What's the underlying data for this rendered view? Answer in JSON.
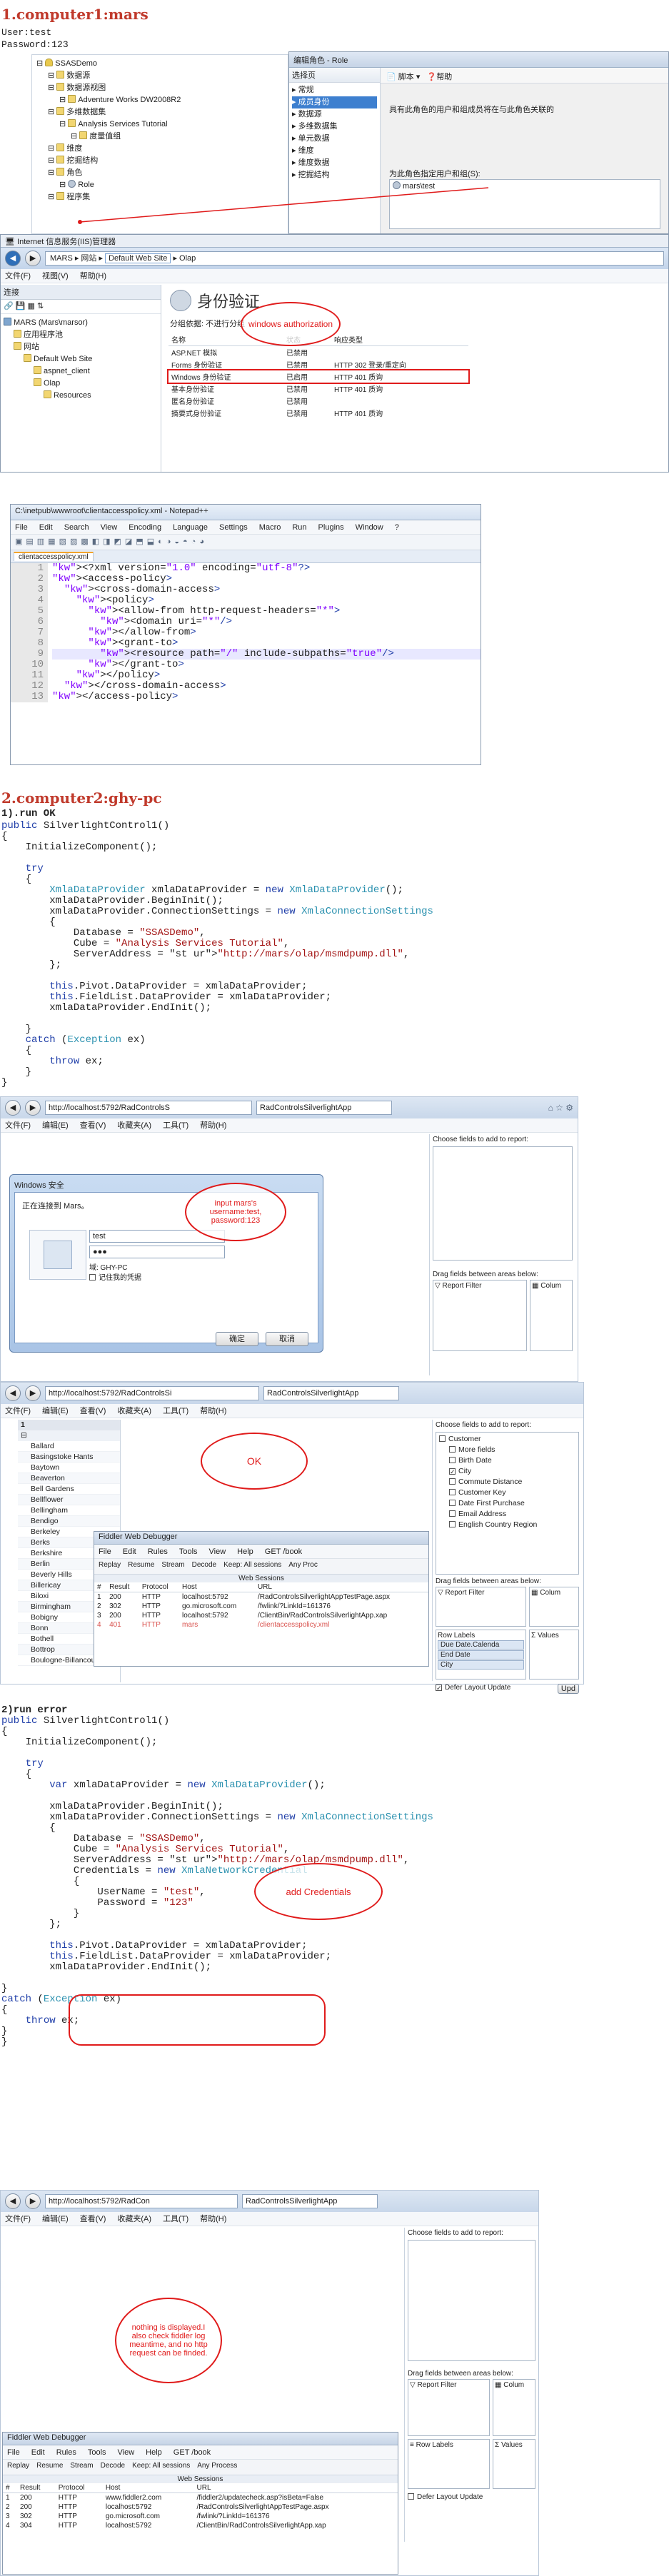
{
  "section1": {
    "heading": "1.computer1:mars",
    "user_line": "User:test",
    "password_line": "Password:123"
  },
  "ssms": {
    "tree": [
      "SSASDemo",
      "数据源",
      "数据源视图",
      "Adventure Works DW2008R2",
      "多维数据集",
      "Analysis Services Tutorial",
      "度量值组",
      "维度",
      "挖掘结构",
      "角色",
      "Role",
      "程序集"
    ],
    "role_window_title": "编辑角色 - Role",
    "select_page_label": "选择页",
    "pages": [
      "常规",
      "成员身份",
      "数据源",
      "多维数据集",
      "单元数据",
      "维度",
      "维度数据",
      "挖掘结构"
    ],
    "toolbar_script": "脚本",
    "toolbar_help": "帮助",
    "membership_desc": "具有此角色的用户和组成员将在与此角色关联的",
    "members_label": "为此角色指定用户和组(S):",
    "member_entry": "mars\\test"
  },
  "iis": {
    "title": "Internet 信息服务(IIS)管理器",
    "address_parts": [
      "MARS",
      "网站",
      "Default Web Site",
      "Olap"
    ],
    "menu": [
      "文件(F)",
      "视图(V)",
      "帮助(H)"
    ],
    "connections_label": "连接",
    "tree": [
      "MARS (Mars\\marsor)",
      "应用程序池",
      "网站",
      "Default Web Site",
      "aspnet_client",
      "Olap",
      "Resources"
    ],
    "page_title": "身份验证",
    "group_by": "分组依据: 不进行分组",
    "columns": [
      "名称",
      "状态",
      "响应类型"
    ],
    "rows": [
      {
        "name": "ASP.NET 模拟",
        "status": "已禁用",
        "response": ""
      },
      {
        "name": "Forms 身份验证",
        "status": "已禁用",
        "response": "HTTP 302 登录/重定向"
      },
      {
        "name": "Windows 身份验证",
        "status": "已启用",
        "response": "HTTP 401 质询"
      },
      {
        "name": "基本身份验证",
        "status": "已禁用",
        "response": "HTTP 401 质询"
      },
      {
        "name": "匿名身份验证",
        "status": "已禁用",
        "response": ""
      },
      {
        "name": "摘要式身份验证",
        "status": "已禁用",
        "response": "HTTP 401 质询"
      }
    ],
    "callout": "windows authorization"
  },
  "notepad": {
    "title": "C:\\inetpub\\wwwroot\\clientaccesspolicy.xml - Notepad++",
    "menu": [
      "File",
      "Edit",
      "Search",
      "View",
      "Encoding",
      "Language",
      "Settings",
      "Macro",
      "Run",
      "Plugins",
      "Window",
      "?"
    ],
    "tab": "clientaccesspolicy.xml",
    "lines": [
      "<?xml version=\"1.0\" encoding=\"utf-8\"?>",
      "<access-policy>",
      "  <cross-domain-access>",
      "    <policy>",
      "      <allow-from http-request-headers=\"*\">",
      "        <domain uri=\"*\"/>",
      "      </allow-from>",
      "      <grant-to>",
      "        <resource path=\"/\" include-subpaths=\"true\"/>",
      "      </grant-to>",
      "    </policy>",
      "  </cross-domain-access>",
      "</access-policy>"
    ]
  },
  "section2": {
    "heading": "2.computer2:ghy-pc",
    "run_ok": "1).run OK",
    "run_error": "2)run error"
  },
  "code1": {
    "lines": [
      "public SilverlightControl1()",
      "{",
      "    InitializeComponent();",
      "",
      "    try",
      "    {",
      "        XmlaDataProvider xmlaDataProvider = new XmlaDataProvider();",
      "        xmlaDataProvider.BeginInit();",
      "        xmlaDataProvider.ConnectionSettings = new XmlaConnectionSettings",
      "        {",
      "            Database = \"SSASDemo\",",
      "            Cube = \"Analysis Services Tutorial\",",
      "            ServerAddress = \"http://mars/olap/msmdpump.dll\",",
      "        };",
      "",
      "        this.Pivot.DataProvider = xmlaDataProvider;",
      "        this.FieldList.DataProvider = xmlaDataProvider;",
      "        xmlaDataProvider.EndInit();",
      "",
      "    }",
      "    catch (Exception ex)",
      "    {",
      "        throw ex;",
      "    }",
      "}"
    ]
  },
  "browser1": {
    "address": "http://localhost:5792/RadControlsS",
    "tab": "RadControlsSilverlightApp",
    "menu": [
      "文件(F)",
      "编辑(E)",
      "查看(V)",
      "收藏夹(A)",
      "工具(T)",
      "帮助(H)"
    ],
    "choose_fields": "Choose fields to add to report:",
    "drag_fields": "Drag fields between areas below:",
    "report_filter": "Report Filter",
    "column_label": "Colum",
    "dialog_title": "Windows 安全",
    "dialog_connecting": "正在连接到 Mars。",
    "username": "test",
    "password_mask": "●●●",
    "domain": "域: GHY-PC",
    "remember": "记住我的凭据",
    "ok": "确定",
    "cancel": "取消",
    "callout": "input mars's username:test, password:123"
  },
  "browser2": {
    "address": "http://localhost:5792/RadControlsSi",
    "tab": "RadControlsSilverlightApp",
    "grid_header": "1",
    "cities": [
      "Ballard",
      "Basingstoke Hants",
      "Baytown",
      "Beaverton",
      "Bell Gardens",
      "Bellflower",
      "Bellingham",
      "Bendigo",
      "Berkeley",
      "Berks",
      "Berkshire",
      "Berlin",
      "Beverly Hills",
      "Billericay",
      "Biloxi",
      "Birmingham",
      "Bobigny",
      "Bonn",
      "Bothell",
      "Bottrop",
      "Boulogne-Billancourt"
    ],
    "fields": [
      {
        "label": "Customer",
        "checked": false,
        "level": 0
      },
      {
        "label": "More fields",
        "checked": false,
        "level": 1
      },
      {
        "label": "Birth Date",
        "checked": false,
        "level": 1
      },
      {
        "label": "City",
        "checked": true,
        "level": 1
      },
      {
        "label": "Commute Distance",
        "checked": false,
        "level": 1
      },
      {
        "label": "Customer Key",
        "checked": false,
        "level": 1
      },
      {
        "label": "Date First Purchase",
        "checked": false,
        "level": 1
      },
      {
        "label": "Email Address",
        "checked": false,
        "level": 1
      },
      {
        "label": "English Country Region",
        "checked": false,
        "level": 1
      }
    ],
    "row_labels": "Row Labels",
    "values": "Values",
    "row_items": [
      "Due Date.Calenda",
      "End Date",
      "City"
    ],
    "defer": "Defer Layout Update",
    "update": "Upd",
    "callout": "OK",
    "fiddler": {
      "title": "Fiddler Web Debugger",
      "menu": [
        "File",
        "Edit",
        "Rules",
        "Tools",
        "View",
        "Help",
        "GET /book"
      ],
      "toolbar": [
        "Replay",
        "Resume",
        "Stream",
        "Decode",
        "Keep: All sessions",
        "Any Proc"
      ],
      "sessions_label": "Web Sessions",
      "columns": [
        "#",
        "Result",
        "Protocol",
        "Host",
        "URL"
      ],
      "rows": [
        [
          "1",
          "200",
          "HTTP",
          "localhost:5792",
          "/RadControlsSilverlightAppTestPage.aspx"
        ],
        [
          "2",
          "302",
          "HTTP",
          "go.microsoft.com",
          "/fwlink/?LinkId=161376"
        ],
        [
          "3",
          "200",
          "HTTP",
          "localhost:5792",
          "/ClientBin/RadControlsSilverlightApp.xap"
        ],
        [
          "4",
          "401",
          "HTTP",
          "mars",
          "/clientaccesspolicy.xml"
        ]
      ]
    }
  },
  "code2": {
    "lines": [
      "public SilverlightControl1()",
      "{",
      "    InitializeComponent();",
      "",
      "    try",
      "    {",
      "        var xmlaDataProvider = new XmlaDataProvider();",
      "",
      "        xmlaDataProvider.BeginInit();",
      "        xmlaDataProvider.ConnectionSettings = new XmlaConnectionSettings",
      "        {",
      "            Database = \"SSASDemo\",",
      "            Cube = \"Analysis Services Tutorial\",",
      "            ServerAddress = \"http://mars/olap/msmdpump.dll\",",
      "            Credentials = new XmlaNetworkCredential",
      "            {",
      "                UserName = \"test\",",
      "                Password = \"123\"",
      "            }",
      "        };",
      "",
      "        this.Pivot.DataProvider = xmlaDataProvider;",
      "        this.FieldList.DataProvider = xmlaDataProvider;",
      "        xmlaDataProvider.EndInit();",
      "",
      "}",
      "catch (Exception ex)",
      "{",
      "    throw ex;",
      "}",
      "}"
    ],
    "callout": "add Credentials"
  },
  "browser3": {
    "address": "http://localhost:5792/RadCon",
    "tab": "RadControlsSilverlightApp",
    "callout": "nothing is displayed.I also check fiddler log meantime, and no http request can be finded.",
    "fiddler": {
      "title": "Fiddler Web Debugger",
      "menu": [
        "File",
        "Edit",
        "Rules",
        "Tools",
        "View",
        "Help",
        "GET /book"
      ],
      "toolbar": [
        "Replay",
        "Resume",
        "Stream",
        "Decode",
        "Keep: All sessions",
        "Any Process"
      ],
      "sessions_label": "Web Sessions",
      "columns": [
        "#",
        "Result",
        "Protocol",
        "Host",
        "URL"
      ],
      "rows": [
        [
          "1",
          "200",
          "HTTP",
          "www.fiddler2.com",
          "/fiddler2/updatecheck.asp?isBeta=False"
        ],
        [
          "2",
          "200",
          "HTTP",
          "localhost:5792",
          "/RadControlsSilverlightAppTestPage.aspx"
        ],
        [
          "3",
          "302",
          "HTTP",
          "go.microsoft.com",
          "/fwlink/?LinkId=161376"
        ],
        [
          "4",
          "304",
          "HTTP",
          "localhost:5792",
          "/ClientBin/RadControlsSilverlightApp.xap"
        ]
      ]
    }
  }
}
